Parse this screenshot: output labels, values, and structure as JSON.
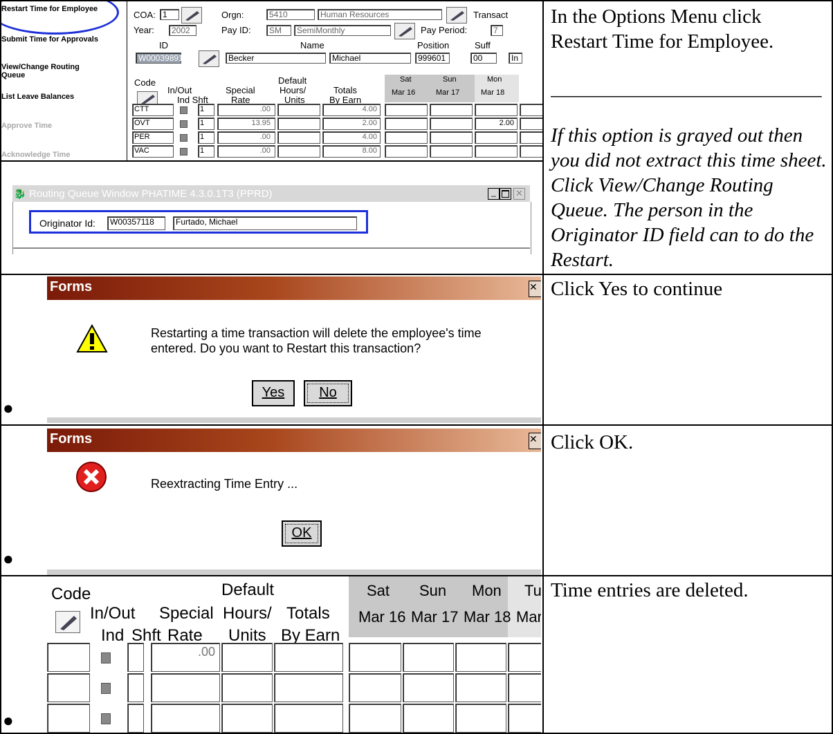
{
  "row1": {
    "menu": [
      "Restart Time for Employee",
      "Submit Time for Approvals",
      "View/Change Routing Queue",
      "List Leave Balances",
      "Approve Time",
      "Acknowledge Time"
    ],
    "coa_label": "COA:",
    "coa_value": "1",
    "orgn_label": "Orgn:",
    "orgn_code": "5410",
    "orgn_name": "Human Resources",
    "transact_label": "Transact",
    "year_label": "Year:",
    "year_value": "2002",
    "payid_label": "Pay ID:",
    "payid_value": "SM",
    "payid_name": "SemiMonthly",
    "payperiod_label": "Pay Period:",
    "payperiod_value": "7",
    "id_head": "ID",
    "name_head": "Name",
    "position_head": "Position",
    "suff_head": "Suff",
    "id_value": "W00039891",
    "last_name": "Becker",
    "first_name": "Michael",
    "position_value": "999601",
    "suff_value": "00",
    "extra_value": "In",
    "grid_head": {
      "code": "Code",
      "inout": "In/Out",
      "indshft": "Ind Shft",
      "special": "Special",
      "rate": "Rate",
      "default": "Default",
      "hours": "Hours/",
      "units": "Units",
      "totals": "Totals",
      "byearn": "By Earn",
      "days": [
        {
          "d": "Sat",
          "date": "Mar 16"
        },
        {
          "d": "Sun",
          "date": "Mar 17"
        },
        {
          "d": "Mon",
          "date": "Mar 18"
        }
      ]
    },
    "rows": [
      {
        "code": "CTT",
        "shft": "1",
        "rate": ".00",
        "total": "4.00",
        "mon": ""
      },
      {
        "code": "OVT",
        "shft": "1",
        "rate": "13.95",
        "total": "2.00",
        "mon": "2.00"
      },
      {
        "code": "PER",
        "shft": "1",
        "rate": ".00",
        "total": "4.00",
        "mon": ""
      },
      {
        "code": "VAC",
        "shft": "1",
        "rate": ".00",
        "total": "8.00",
        "mon": ""
      }
    ],
    "routing_title": "Routing Queue Window  PHATIME  4.3.0.1T3  (PPRD)",
    "originator_label": "Originator Id:",
    "originator_id": "W00357118",
    "originator_name": "Furtado, Michael",
    "instr1": "In the Options Menu click Restart Time for Employee.",
    "rule": "___________________________",
    "instr2": "If this option is grayed out then you did not extract this time sheet.  Click View/Change Routing Queue.  The person in the Originator ID field can to do the Restart."
  },
  "row2": {
    "title": "Forms",
    "message": "Restarting a time transaction will delete the employee's time entered.  Do you want to Restart this transaction?",
    "yes": "Yes",
    "no": "No",
    "instr": "Click Yes to continue"
  },
  "row3": {
    "title": "Forms",
    "message": "Reextracting Time Entry ...",
    "ok": "OK",
    "instr": "Click OK."
  },
  "row4": {
    "code": "Code",
    "inout": "In/Out",
    "indshft": "Ind Shft",
    "special": "Special",
    "rate": "Rate",
    "default": "Default",
    "hours": "Hours/",
    "units": "Units",
    "totals": "Totals",
    "byearn": "By Earn",
    "days": [
      {
        "d": "Sat",
        "date": "Mar 16"
      },
      {
        "d": "Sun",
        "date": "Mar 17"
      },
      {
        "d": "Mon",
        "date": "Mar 18"
      },
      {
        "d": "Tu",
        "date": "Mar"
      }
    ],
    "rate_value": ".00",
    "instr": "Time entries are deleted."
  },
  "bullet": "●"
}
